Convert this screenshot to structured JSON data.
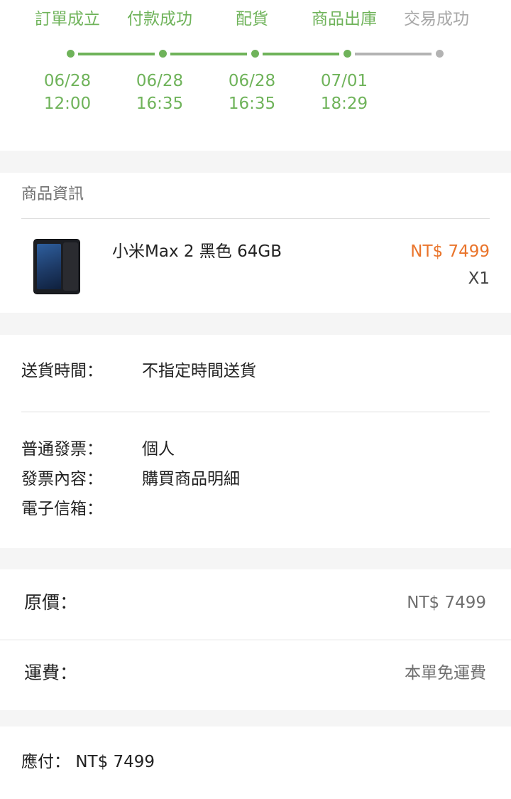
{
  "steps": [
    {
      "label": "訂單成立",
      "date": "06/28",
      "time": "12:00",
      "done": true
    },
    {
      "label": "付款成功",
      "date": "06/28",
      "time": "16:35",
      "done": true
    },
    {
      "label": "配貨",
      "date": "06/28",
      "time": "16:35",
      "done": true
    },
    {
      "label": "商品出庫",
      "date": "07/01",
      "time": "18:29",
      "done": true
    },
    {
      "label": "交易成功",
      "date": "",
      "time": "",
      "done": false
    }
  ],
  "product_section": {
    "title": "商品資訊",
    "product": {
      "name": "小米Max 2 黑色 64GB",
      "price": "NT$ 7499",
      "quantity": "X1",
      "image_icon": "phone-thumbnail"
    }
  },
  "delivery": {
    "time_label": "送貨時間：",
    "time_value": "不指定時間送貨"
  },
  "invoice": {
    "type_label": "普通發票：",
    "type_value": "個人",
    "content_label": "發票內容：",
    "content_value": "購買商品明細",
    "email_label": "電子信箱：",
    "email_value": ""
  },
  "fees": {
    "original_label": "原價：",
    "original_value": "NT$ 7499",
    "shipping_label": "運費：",
    "shipping_value": "本單免運費"
  },
  "total": {
    "label": "應付：",
    "value": "NT$ 7499"
  },
  "colors": {
    "progress_done": "#6fb35a",
    "progress_pending": "#b3b3b3",
    "price": "#e9742b"
  }
}
